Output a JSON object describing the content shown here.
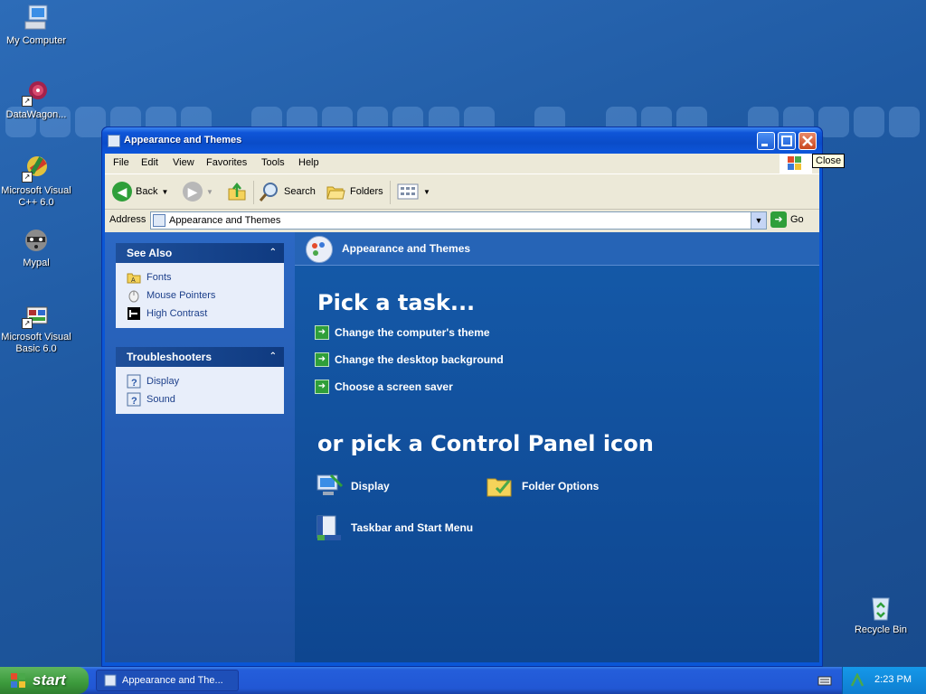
{
  "desktop": {
    "icons": [
      {
        "label": "My Computer"
      },
      {
        "label": "DataWagon..."
      },
      {
        "label": "Microsoft Visual C++ 6.0"
      },
      {
        "label": "Mypal"
      },
      {
        "label": "Microsoft Visual Basic 6.0"
      },
      {
        "label": "Recycle Bin"
      }
    ]
  },
  "window": {
    "title": "Appearance and Themes",
    "tooltip": "Close",
    "menu": [
      "File",
      "Edit",
      "View",
      "Favorites",
      "Tools",
      "Help"
    ],
    "toolbar": {
      "back_label": "Back",
      "search_label": "Search",
      "folders_label": "Folders"
    },
    "address": {
      "label": "Address",
      "value": "Appearance and Themes",
      "go_label": "Go"
    },
    "see_also": {
      "title": "See Also",
      "items": [
        {
          "label": "Fonts",
          "icon": "fonts-folder-icon"
        },
        {
          "label": "Mouse Pointers",
          "icon": "mouse-icon"
        },
        {
          "label": "High Contrast",
          "icon": "contrast-icon"
        }
      ]
    },
    "troubleshooters": {
      "title": "Troubleshooters",
      "items": [
        {
          "label": "Display",
          "icon": "help-icon"
        },
        {
          "label": "Sound",
          "icon": "help-icon"
        }
      ]
    },
    "content": {
      "header": "Appearance and Themes",
      "pick_task": "Pick a task...",
      "tasks": [
        "Change the computer's theme",
        "Change the desktop background",
        "Choose a screen saver"
      ],
      "pick_icon": "or pick a Control Panel icon",
      "icons": [
        {
          "label": "Display"
        },
        {
          "label": "Folder Options"
        },
        {
          "label": "Taskbar and Start Menu"
        }
      ]
    }
  },
  "taskbar": {
    "start_label": "start",
    "task_label": "Appearance and The...",
    "clock": "2:23 PM"
  },
  "colors": {
    "desktop": "#1f5aa3",
    "titlebar": "#0a4cc8",
    "start_green": "#3c9a3c",
    "task_arrow": "#2f9f3a"
  }
}
